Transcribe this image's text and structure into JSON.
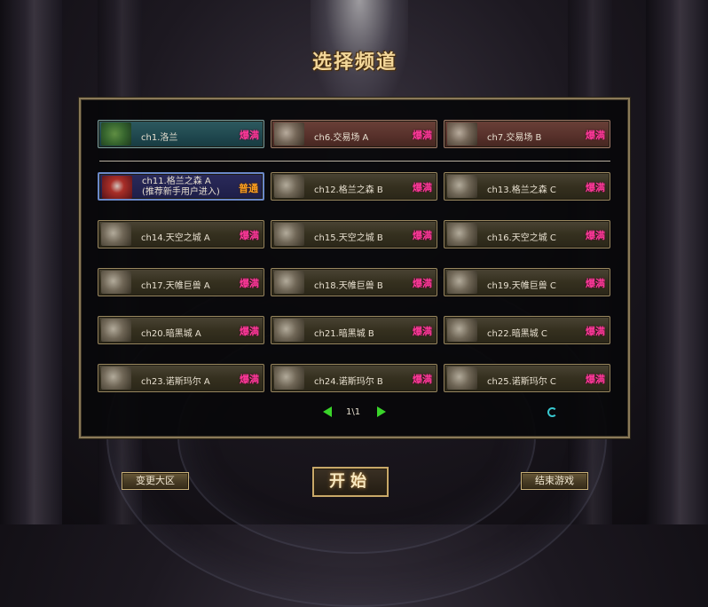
{
  "title": "选择频道",
  "channels": [
    {
      "name": "ch1.洛兰",
      "sub": "",
      "status": "爆满"
    },
    {
      "name": "ch6.交易场 A",
      "sub": "",
      "status": "爆满"
    },
    {
      "name": "ch7.交易场 B",
      "sub": "",
      "status": "爆满"
    },
    {
      "name": "ch11.格兰之森 A",
      "sub": "(推荐新手用户进入)",
      "status": "普通"
    },
    {
      "name": "ch12.格兰之森 B",
      "sub": "",
      "status": "爆满"
    },
    {
      "name": "ch13.格兰之森 C",
      "sub": "",
      "status": "爆满"
    },
    {
      "name": "ch14.天空之城 A",
      "sub": "",
      "status": "爆满"
    },
    {
      "name": "ch15.天空之城 B",
      "sub": "",
      "status": "爆满"
    },
    {
      "name": "ch16.天空之城 C",
      "sub": "",
      "status": "爆满"
    },
    {
      "name": "ch17.天帷巨兽 A",
      "sub": "",
      "status": "爆满"
    },
    {
      "name": "ch18.天帷巨兽 B",
      "sub": "",
      "status": "爆满"
    },
    {
      "name": "ch19.天帷巨兽 C",
      "sub": "",
      "status": "爆满"
    },
    {
      "name": "ch20.暗黑城 A",
      "sub": "",
      "status": "爆满"
    },
    {
      "name": "ch21.暗黑城 B",
      "sub": "",
      "status": "爆满"
    },
    {
      "name": "ch22.暗黑城 C",
      "sub": "",
      "status": "爆满"
    },
    {
      "name": "ch23.诺斯玛尔 A",
      "sub": "",
      "status": "爆满"
    },
    {
      "name": "ch24.诺斯玛尔 B",
      "sub": "",
      "status": "爆满"
    },
    {
      "name": "ch25.诺斯玛尔 C",
      "sub": "",
      "status": "爆满"
    }
  ],
  "pager": {
    "text": "1\\1"
  },
  "buttons": {
    "change_region": "变更大区",
    "start": "开始",
    "exit": "结束游戏"
  },
  "colors": {
    "status_full": "#ff3a9a",
    "status_normal": "#ffa020",
    "frame": "#8a7a58"
  },
  "icons": {
    "prev_page": "left-arrow-icon",
    "next_page": "right-arrow-icon",
    "refresh": "refresh-icon"
  }
}
